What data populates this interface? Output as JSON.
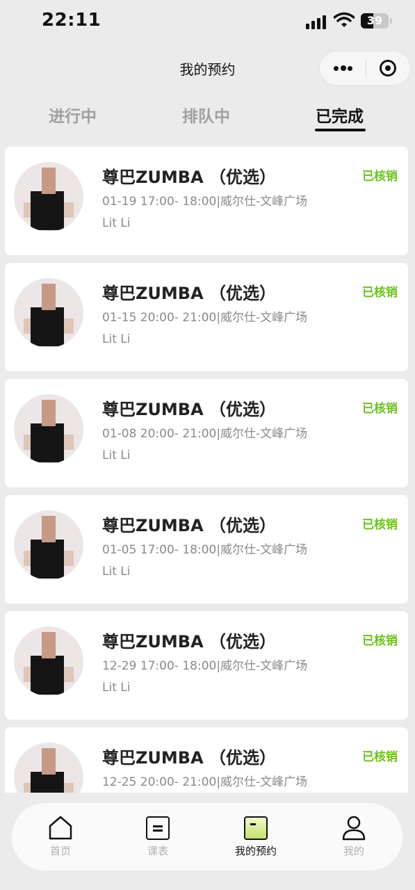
{
  "status_bar": {
    "time": "22:11",
    "battery": "39"
  },
  "nav": {
    "title": "我的预约"
  },
  "tabs": [
    {
      "label": "进行中"
    },
    {
      "label": "排队中"
    },
    {
      "label": "已完成"
    }
  ],
  "bookings": [
    {
      "title": "尊巴ZUMBA （优选）",
      "time_location": "01-19 17:00- 18:00|威尔仕-文峰广场",
      "coach": "Lit Li",
      "status": "已核销"
    },
    {
      "title": "尊巴ZUMBA （优选）",
      "time_location": "01-15 20:00- 21:00|威尔仕-文峰广场",
      "coach": "Lit Li",
      "status": "已核销"
    },
    {
      "title": "尊巴ZUMBA （优选）",
      "time_location": "01-08 20:00- 21:00|威尔仕-文峰广场",
      "coach": "Lit Li",
      "status": "已核销"
    },
    {
      "title": "尊巴ZUMBA （优选）",
      "time_location": "01-05 17:00- 18:00|威尔仕-文峰广场",
      "coach": "Lit Li",
      "status": "已核销"
    },
    {
      "title": "尊巴ZUMBA （优选）",
      "time_location": "12-29 17:00- 18:00|威尔仕-文峰广场",
      "coach": "Lit Li",
      "status": "已核销"
    },
    {
      "title": "尊巴ZUMBA （优选）",
      "time_location": "12-25 20:00- 21:00|威尔仕-文峰广场",
      "coach": "",
      "status": "已核销"
    }
  ],
  "tabbar": [
    {
      "label": "首页",
      "icon": "home-icon"
    },
    {
      "label": "课表",
      "icon": "schedule-icon"
    },
    {
      "label": "我的预约",
      "icon": "booking-icon"
    },
    {
      "label": "我的",
      "icon": "user-icon"
    }
  ],
  "colors": {
    "status_green": "#6cc21c",
    "background": "#ebebeb"
  }
}
